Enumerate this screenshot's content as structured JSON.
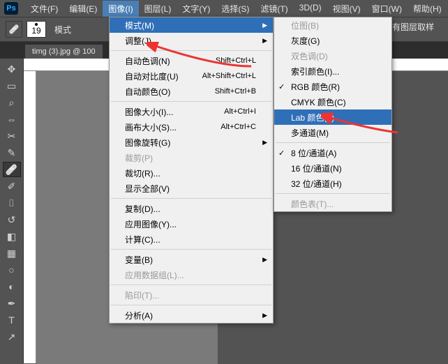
{
  "menubar": {
    "items": [
      {
        "label": "文件(F)"
      },
      {
        "label": "编辑(E)"
      },
      {
        "label": "图像(I)"
      },
      {
        "label": "图层(L)"
      },
      {
        "label": "文字(Y)"
      },
      {
        "label": "选择(S)"
      },
      {
        "label": "滤镜(T)"
      },
      {
        "label": "3D(D)"
      },
      {
        "label": "视图(V)"
      },
      {
        "label": "窗口(W)"
      },
      {
        "label": "帮助(H)"
      }
    ]
  },
  "optionsbar": {
    "brush_size": "19",
    "mode_label": "模式",
    "sample_label": "对所有图层取样"
  },
  "document": {
    "tab_title": "timg (3).jpg @ 100"
  },
  "dropdown": {
    "items": [
      {
        "label": "模式(M)",
        "arrow": true,
        "hi": true
      },
      {
        "label": "调整(J)",
        "arrow": true
      },
      {
        "sep": true
      },
      {
        "label": "自动色调(N)",
        "sc": "Shift+Ctrl+L"
      },
      {
        "label": "自动对比度(U)",
        "sc": "Alt+Shift+Ctrl+L"
      },
      {
        "label": "自动颜色(O)",
        "sc": "Shift+Ctrl+B"
      },
      {
        "sep": true
      },
      {
        "label": "图像大小(I)...",
        "sc": "Alt+Ctrl+I"
      },
      {
        "label": "画布大小(S)...",
        "sc": "Alt+Ctrl+C"
      },
      {
        "label": "图像旋转(G)",
        "arrow": true
      },
      {
        "label": "裁剪(P)",
        "dis": true
      },
      {
        "label": "裁切(R)..."
      },
      {
        "label": "显示全部(V)"
      },
      {
        "sep": true
      },
      {
        "label": "复制(D)..."
      },
      {
        "label": "应用图像(Y)..."
      },
      {
        "label": "计算(C)..."
      },
      {
        "sep": true
      },
      {
        "label": "变量(B)",
        "arrow": true
      },
      {
        "label": "应用数据组(L)...",
        "dis": true
      },
      {
        "sep": true
      },
      {
        "label": "陷印(T)...",
        "dis": true
      },
      {
        "sep": true
      },
      {
        "label": "分析(A)",
        "arrow": true
      }
    ]
  },
  "submenu": {
    "items": [
      {
        "label": "位图(B)",
        "dis": true
      },
      {
        "label": "灰度(G)"
      },
      {
        "label": "双色调(D)",
        "dis": true
      },
      {
        "label": "索引颜色(I)..."
      },
      {
        "label": "RGB 颜色(R)",
        "chk": true
      },
      {
        "label": "CMYK 颜色(C)"
      },
      {
        "label": "Lab 颜色(L)",
        "hi": true
      },
      {
        "label": "多通道(M)"
      },
      {
        "sep": true
      },
      {
        "label": "8 位/通道(A)",
        "chk": true
      },
      {
        "label": "16 位/通道(N)"
      },
      {
        "label": "32 位/通道(H)"
      },
      {
        "sep": true
      },
      {
        "label": "颜色表(T)...",
        "dis": true
      }
    ]
  },
  "ps_logo": "Ps"
}
